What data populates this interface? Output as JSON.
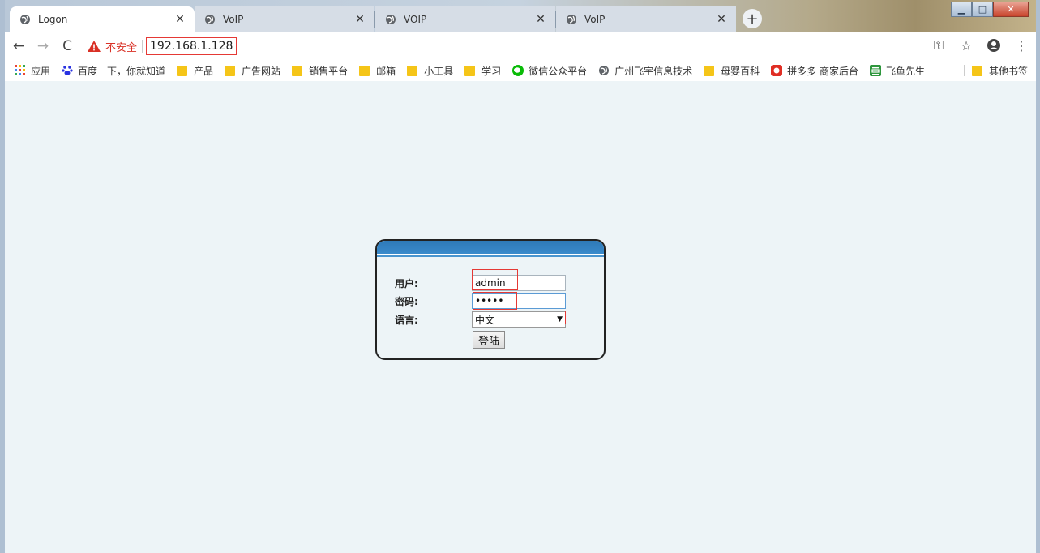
{
  "tabs": [
    {
      "title": "Logon",
      "active": true
    },
    {
      "title": "VoIP",
      "active": false
    },
    {
      "title": "VOIP",
      "active": false
    },
    {
      "title": "VoIP",
      "active": false
    }
  ],
  "toolbar": {
    "insecure_label": "不安全",
    "url": "192.168.1.128"
  },
  "bookmarks": {
    "apps": "应用",
    "items": [
      "百度一下，你就知道",
      "产品",
      "广告网站",
      "销售平台",
      "邮箱",
      "小工具",
      "学习",
      "微信公众平台",
      "广州飞宇信息技术",
      "母婴百科",
      "拼多多 商家后台",
      "飞鱼先生"
    ],
    "other": "其他书签"
  },
  "login": {
    "user_label": "用户:",
    "user_value": "admin",
    "password_label": "密码:",
    "password_value": "•••••",
    "language_label": "语言:",
    "language_value": "中文",
    "submit_label": "登陆"
  },
  "colors": {
    "accent_header": "#3a8acb",
    "content_bg": "#edf4f7",
    "highlight": "#e53935",
    "insecure": "#d93025"
  },
  "icons": [
    "globe-icon",
    "close-icon",
    "plus-icon",
    "back-icon",
    "forward-icon",
    "reload-icon",
    "warning-icon",
    "key-icon",
    "star-icon",
    "account-icon",
    "menu-icon",
    "apps-grid-icon",
    "folder-icon",
    "wechat-icon",
    "dropdown-arrow-icon"
  ]
}
